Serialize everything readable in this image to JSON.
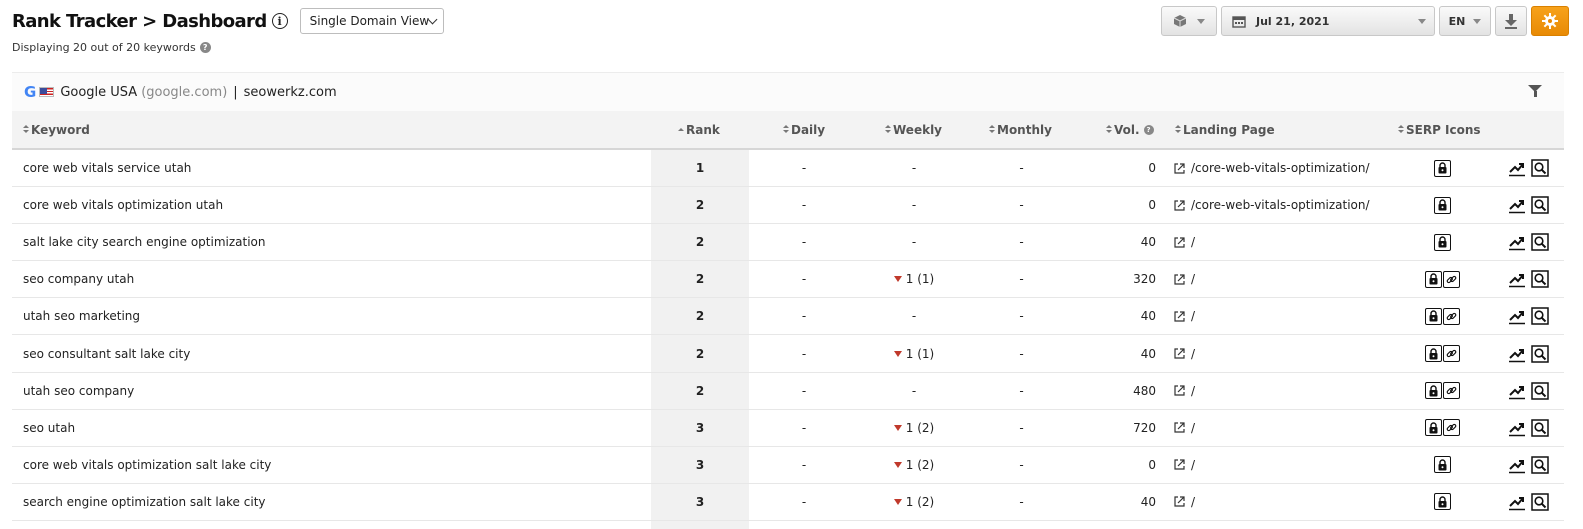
{
  "header": {
    "title": "Rank Tracker > Dashboard",
    "view_select": "Single Domain View",
    "subtitle": "Displaying 20 out of 20 keywords"
  },
  "toolbar": {
    "date": "Jul 21, 2021",
    "language": "EN",
    "gear_color": "#f39c12"
  },
  "engine": {
    "logo": "G",
    "name": "Google USA",
    "domain": "(google.com)",
    "separator": "|",
    "site": "seowerkz.com"
  },
  "columns": {
    "keyword": "Keyword",
    "rank": "Rank",
    "daily": "Daily",
    "weekly": "Weekly",
    "monthly": "Monthly",
    "vol": "Vol.",
    "landing": "Landing Page",
    "serp": "SERP Icons"
  },
  "rows": [
    {
      "keyword": "core web vitals service utah",
      "rank": "1",
      "daily": "-",
      "weekly": "-",
      "weekly_change": false,
      "monthly": "-",
      "vol": "0",
      "landing": "/core-web-vitals-optimization/",
      "serp": [
        "lock-icon"
      ]
    },
    {
      "keyword": "core web vitals optimization utah",
      "rank": "2",
      "daily": "-",
      "weekly": "-",
      "weekly_change": false,
      "monthly": "-",
      "vol": "0",
      "landing": "/core-web-vitals-optimization/",
      "serp": [
        "lock-icon"
      ]
    },
    {
      "keyword": "salt lake city search engine optimization",
      "rank": "2",
      "daily": "-",
      "weekly": "-",
      "weekly_change": false,
      "monthly": "-",
      "vol": "40",
      "landing": "/",
      "serp": [
        "lock-icon"
      ]
    },
    {
      "keyword": "seo company utah",
      "rank": "2",
      "daily": "-",
      "weekly": "1 (1)",
      "weekly_change": true,
      "monthly": "-",
      "vol": "320",
      "landing": "/",
      "serp": [
        "lock-icon",
        "link-icon"
      ]
    },
    {
      "keyword": "utah seo marketing",
      "rank": "2",
      "daily": "-",
      "weekly": "-",
      "weekly_change": false,
      "monthly": "-",
      "vol": "40",
      "landing": "/",
      "serp": [
        "lock-icon",
        "link-icon"
      ]
    },
    {
      "keyword": "seo consultant salt lake city",
      "rank": "2",
      "daily": "-",
      "weekly": "1 (1)",
      "weekly_change": true,
      "monthly": "-",
      "vol": "40",
      "landing": "/",
      "serp": [
        "lock-icon",
        "link-icon"
      ]
    },
    {
      "keyword": "utah seo company",
      "rank": "2",
      "daily": "-",
      "weekly": "-",
      "weekly_change": false,
      "monthly": "-",
      "vol": "480",
      "landing": "/",
      "serp": [
        "lock-icon",
        "link-icon"
      ]
    },
    {
      "keyword": "seo utah",
      "rank": "3",
      "daily": "-",
      "weekly": "1 (2)",
      "weekly_change": true,
      "monthly": "-",
      "vol": "720",
      "landing": "/",
      "serp": [
        "lock-icon",
        "link-icon"
      ]
    },
    {
      "keyword": "core web vitals optimization salt lake city",
      "rank": "3",
      "daily": "-",
      "weekly": "1 (2)",
      "weekly_change": true,
      "monthly": "-",
      "vol": "0",
      "landing": "/",
      "serp": [
        "lock-icon"
      ]
    },
    {
      "keyword": "search engine optimization salt lake city",
      "rank": "3",
      "daily": "-",
      "weekly": "1 (2)",
      "weekly_change": true,
      "monthly": "-",
      "vol": "40",
      "landing": "/",
      "serp": [
        "lock-icon"
      ]
    }
  ]
}
